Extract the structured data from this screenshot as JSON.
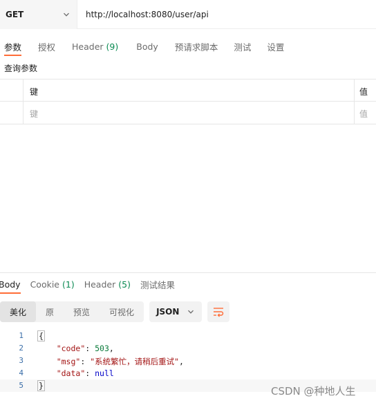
{
  "request": {
    "method": "GET",
    "url": "http://localhost:8080/user/api"
  },
  "request_tabs": [
    {
      "label": "参数",
      "active": true
    },
    {
      "label": "授权",
      "active": false
    },
    {
      "label": "Header",
      "count": "(9)",
      "active": false
    },
    {
      "label": "Body",
      "active": false
    },
    {
      "label": "预请求脚本",
      "active": false
    },
    {
      "label": "测试",
      "active": false
    },
    {
      "label": "设置",
      "active": false
    }
  ],
  "query_params": {
    "title": "查询参数",
    "header_key": "键",
    "header_value": "值",
    "placeholder_key": "键",
    "placeholder_value": "值"
  },
  "response_tabs": [
    {
      "label": "Body",
      "active": true
    },
    {
      "label": "Cookie",
      "count": "(1)",
      "active": false
    },
    {
      "label": "Header",
      "count": "(5)",
      "active": false
    },
    {
      "label": "测试结果",
      "active": false
    }
  ],
  "view_modes": [
    "美化",
    "原",
    "预览",
    "可视化"
  ],
  "active_view_mode": "美化",
  "format": "JSON",
  "response_body": {
    "line_numbers": [
      "1",
      "2",
      "3",
      "4",
      "5"
    ],
    "open_brace": "{",
    "close_brace": "}",
    "fields": [
      {
        "key": "\"code\"",
        "value": "503",
        "kind": "number"
      },
      {
        "key": "\"msg\"",
        "value": "\"系统繁忙，请稍后重试\"",
        "kind": "string"
      },
      {
        "key": "\"data\"",
        "value": "null",
        "kind": "null"
      }
    ]
  },
  "watermark": "CSDN @种地人生",
  "colors": {
    "accent": "#ff6c37",
    "count_green": "#0a8a52"
  },
  "icons": {
    "method_dropdown": "chevron-down-icon",
    "format_dropdown": "chevron-down-icon",
    "wrap": "wrap-lines-icon"
  }
}
